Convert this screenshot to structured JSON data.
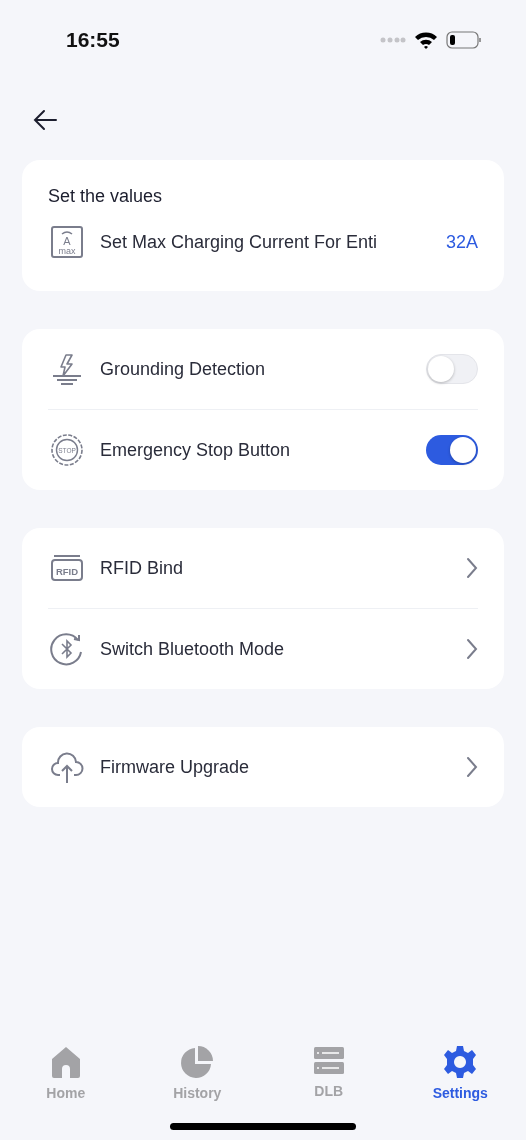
{
  "status_bar": {
    "time": "16:55"
  },
  "cards": [
    {
      "title": "Set the values",
      "rows": [
        {
          "kind": "value",
          "icon_text": [
            "A",
            "max"
          ],
          "label": "Set Max Charging Current For Enti",
          "value": "32A"
        }
      ]
    },
    {
      "rows": [
        {
          "kind": "toggle",
          "label": "Grounding Detection",
          "on": false
        },
        {
          "kind": "toggle",
          "icon_text": [
            "STOP"
          ],
          "label": "Emergency Stop Button",
          "on": true
        }
      ]
    },
    {
      "rows": [
        {
          "kind": "link",
          "icon_text": [
            "RFID"
          ],
          "label": "RFID Bind"
        },
        {
          "kind": "link",
          "label": "Switch Bluetooth Mode"
        }
      ]
    },
    {
      "rows": [
        {
          "kind": "link",
          "label": "Firmware Upgrade"
        }
      ]
    }
  ],
  "tab_bar": [
    {
      "label": "Home",
      "selected": false
    },
    {
      "label": "History",
      "selected": false
    },
    {
      "label": "DLB",
      "selected": false
    },
    {
      "label": "Settings",
      "selected": true
    }
  ]
}
